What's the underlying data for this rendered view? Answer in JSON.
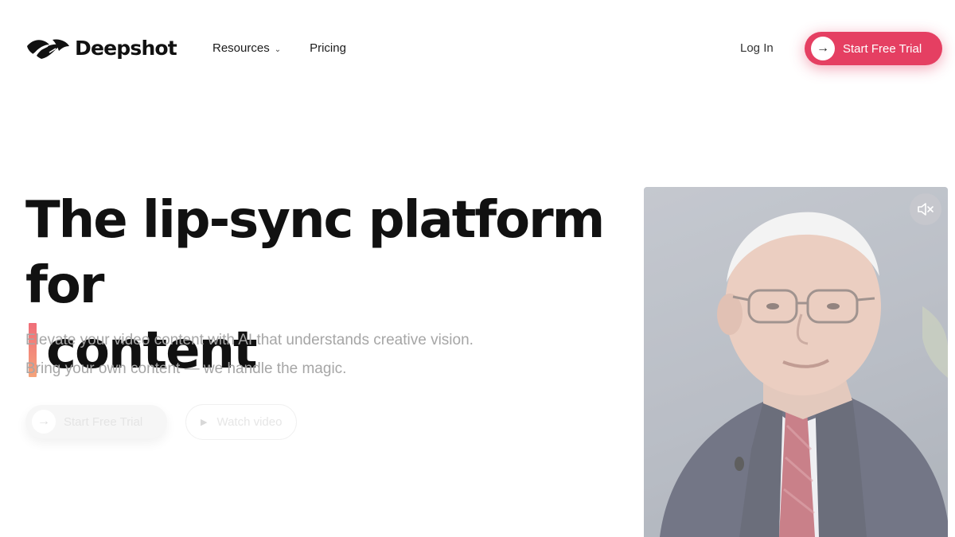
{
  "brand": {
    "name": "Deepshot",
    "accent": "#e53f62"
  },
  "nav": {
    "items": [
      {
        "label": "Resources",
        "has_dropdown": true
      },
      {
        "label": "Pricing",
        "has_dropdown": false
      }
    ],
    "login_label": "Log In",
    "cta_label": "Start Free Trial"
  },
  "hero": {
    "title_line1": "The lip-sync platform for",
    "title_line2": "content",
    "subtitle_line1": "Elevate your video content with AI that understands creative vision.",
    "subtitle_line2": "Bring your own content — we handle the magic.",
    "primary_cta": "Start Free Trial",
    "secondary_cta": "Watch video"
  },
  "icons": {
    "arrow": "arrow-right-icon",
    "chevron": "chevron-down-icon",
    "play": "play-icon",
    "mute": "speaker-muted-icon"
  }
}
